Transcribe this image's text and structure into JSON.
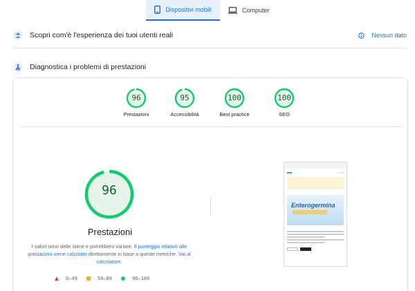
{
  "tabs": [
    {
      "label": "Dispositivi mobili",
      "icon": "smartphone-icon",
      "active": true
    },
    {
      "label": "Computer",
      "icon": "laptop-icon",
      "active": false
    }
  ],
  "field_data": {
    "title": "Scopri com'è l'esperienza dei tuoi utenti reali",
    "status": "Nessun dato",
    "icon": "users-icon"
  },
  "lab_data": {
    "title": "Diagnostica i problemi di prestazioni",
    "icon": "lab-icon"
  },
  "scores": [
    {
      "value": "96",
      "label": "Prestazioni",
      "fraction": 0.96
    },
    {
      "value": "95",
      "label": "Accessibilità",
      "fraction": 0.95
    },
    {
      "value": "100",
      "label": "Best practice",
      "fraction": 1.0
    },
    {
      "value": "100",
      "label": "SEO",
      "fraction": 1.0
    }
  ],
  "main_score": {
    "value": "96",
    "fraction": 0.96,
    "title": "Prestazioni",
    "disclaimer_pre": "I valori sono delle stime e potrebbero variare. Il ",
    "disclaimer_link1": "punteggio relativo alle prestazioni viene calcolato",
    "disclaimer_mid": " direttamente in base a queste metriche. ",
    "disclaimer_link2": "Vai al calcolatore."
  },
  "legend": [
    {
      "range": "0–49",
      "shape": "triangle",
      "color": "#e8453c"
    },
    {
      "range": "50–89",
      "shape": "square",
      "color": "#f6ae2e"
    },
    {
      "range": "90–100",
      "shape": "circle",
      "color": "#0cce6b"
    }
  ],
  "thumbnail": {
    "brand": "Enterogermina"
  },
  "colors": {
    "accent": "#1a73e8",
    "pass_ring": "#0cce6b",
    "pass_fill": "#e6f4ea",
    "pass_text": "#0d652d"
  }
}
